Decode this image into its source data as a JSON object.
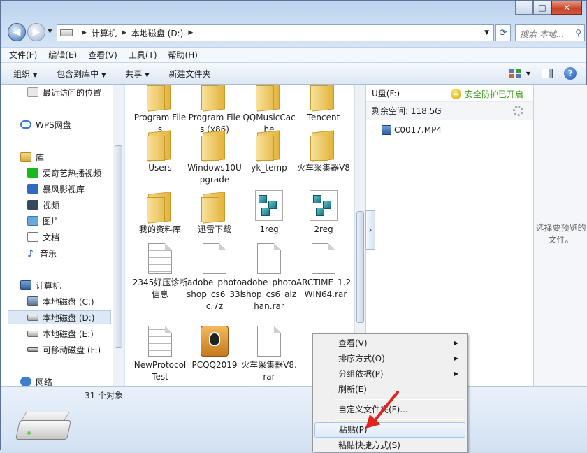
{
  "window": {
    "controls": {
      "minimize": "—",
      "maximize": "□",
      "close": "✕"
    }
  },
  "address": {
    "crumbs": [
      "计算机",
      "本地磁盘 (D:)"
    ],
    "search_placeholder": "搜索 本地..."
  },
  "menubar": [
    "文件(F)",
    "编辑(E)",
    "查看(V)",
    "工具(T)",
    "帮助(H)"
  ],
  "toolbar": {
    "organize": "组织",
    "include": "包含到库中",
    "share": "共享",
    "new_folder": "新建文件夹"
  },
  "nav": {
    "recent": "最近访问的位置",
    "wps": "WPS网盘",
    "libraries": "库",
    "iqiyi": "爱奇艺热播视频",
    "storm": "暴风影视库",
    "video": "视频",
    "pictures": "图片",
    "documents": "文档",
    "music": "音乐",
    "computer": "计算机",
    "drive_c": "本地磁盘 (C:)",
    "drive_d": "本地磁盘 (D:)",
    "drive_e": "本地磁盘 (E:)",
    "drive_f": "可移动磁盘 (F:)",
    "network": "网络"
  },
  "files": {
    "f1": "Program Files",
    "f2": "Program Files (x86)",
    "f3": "QQMusicCache",
    "f4": "Tencent",
    "f5": "Users",
    "f6": "Windows10Upgrade",
    "f7": "yk_temp",
    "f8": "火车采集器V8",
    "f9": "我的资料库",
    "f10": "迅雷下载",
    "f11": "1reg",
    "f12": "2reg",
    "f13": "2345好压诊断信息",
    "f14": "adobe_photoshop_cs6_33lc.7z",
    "f15": "adobe_photoshop_cs6_aizhan.rar",
    "f16": "ARCTIME_1.2_WIN64.rar",
    "f17": "NewProtocolTest",
    "f18": "PCQQ2019",
    "f19": "火车采集器V8.rar"
  },
  "usb": {
    "name": "U盘(F:)",
    "safe": "安全防护已开启",
    "space": "剩余空间: 118.5G",
    "file": "C0017.MP4"
  },
  "preview": {
    "text": "选择要预览的文件。"
  },
  "details": {
    "count": "31 个对象"
  },
  "context_menu": {
    "view": "查看(V)",
    "sort": "排序方式(O)",
    "group": "分组依据(P)",
    "refresh": "刷新(E)",
    "customize": "自定义文件夹(F)...",
    "paste": "粘贴(P)",
    "paste_shortcut": "粘贴快捷方式(S)"
  },
  "colors": {
    "accent": "#3a7bd5",
    "safe_green": "#3a9a13",
    "arrow_red": "#e3231c"
  }
}
